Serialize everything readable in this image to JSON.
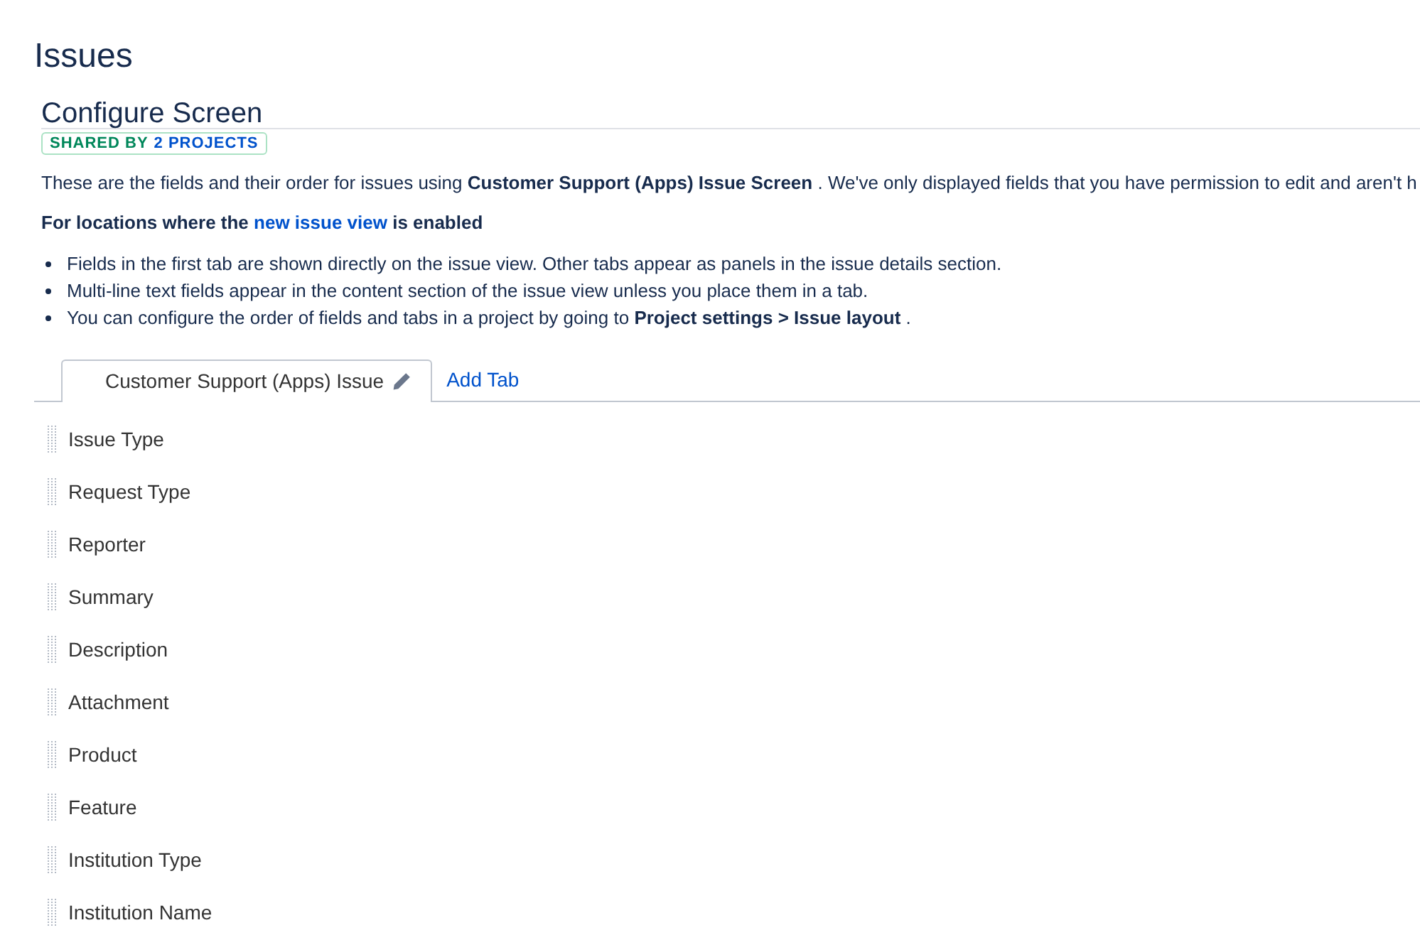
{
  "page": {
    "title": "Issues"
  },
  "screen": {
    "title": "Configure Screen",
    "badge": {
      "label": "SHARED BY",
      "link": "2 PROJECTS"
    },
    "description": "These are the fields and their order for issues using **Customer Support (Apps) Issue Screen** . We've only displayed fields that you have permission to edit and aren't h",
    "notice": {
      "before": "For locations where the",
      "link": "new issue view",
      "after": "is enabled"
    },
    "notes": [
      "Fields in the first tab are shown directly on the issue view. Other tabs appear as panels in the issue details section.",
      "Multi-line text fields appear in the content section of the issue view unless you place them in a tab.",
      "You can configure the order of fields and tabs in a project by going to **Project settings > Issue layout** ."
    ]
  },
  "tabs": [
    {
      "label": "Customer Support (Apps) Issue",
      "selected": true
    }
  ],
  "add_tab": "Add Tab",
  "fields": [
    "Issue Type",
    "Request Type",
    "Reporter",
    "Summary",
    "Description",
    "Attachment",
    "Product",
    "Feature",
    "Institution Type",
    "Institution Name"
  ]
}
